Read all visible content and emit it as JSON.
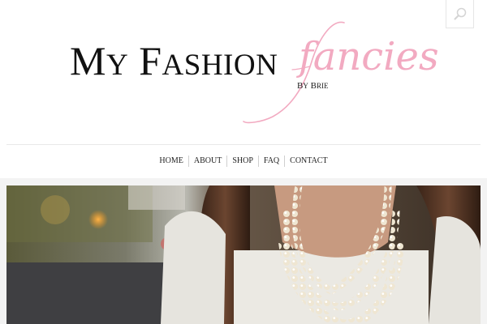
{
  "site": {
    "logo_main": "My Fashion",
    "logo_script": "fancies",
    "logo_byline": "By Brie"
  },
  "nav": {
    "items": [
      "HOME",
      "ABOUT",
      "SHOP",
      "FAQ",
      "CONTACT"
    ]
  },
  "icons": {
    "search": "search-icon"
  },
  "colors": {
    "accent_pink": "#f2aac1",
    "text": "#111111",
    "page_bg": "#f3f3f3"
  }
}
